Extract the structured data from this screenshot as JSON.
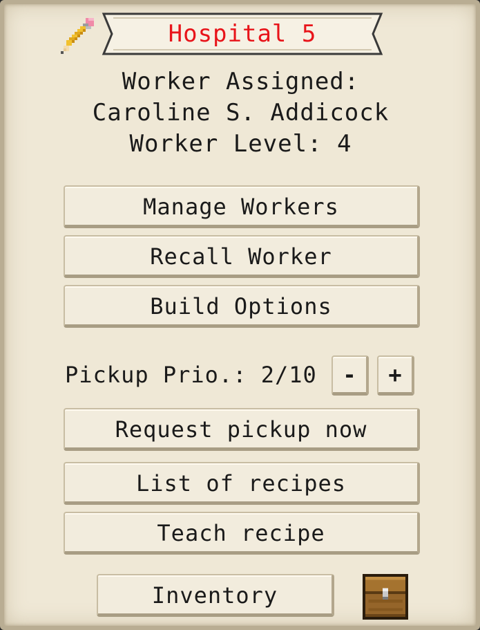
{
  "title": "Hospital 5",
  "worker": {
    "assigned_label": "Worker Assigned:",
    "name": "Caroline S. Addicock",
    "level_text": "Worker Level: 4"
  },
  "buttons": {
    "manage_workers": "Manage Workers",
    "recall_worker": "Recall Worker",
    "build_options": "Build Options",
    "request_pickup": "Request pickup now",
    "list_recipes": "List of recipes",
    "teach_recipe": "Teach recipe",
    "inventory": "Inventory"
  },
  "pickup": {
    "label": "Pickup Prio.: 2/10",
    "minus": "-",
    "plus": "+"
  },
  "colors": {
    "title": "#e8141a",
    "parchment": "#efe8d6"
  },
  "icons": {
    "edit": "pencil-icon",
    "inventory": "chest-icon"
  }
}
